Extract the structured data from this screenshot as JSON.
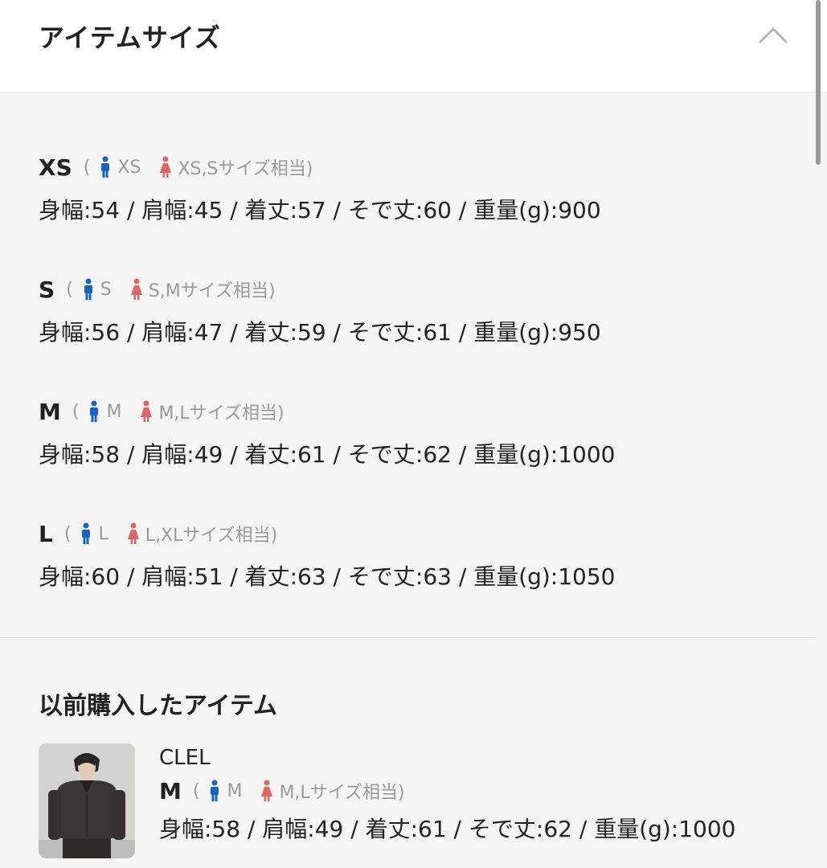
{
  "header": {
    "title": "アイテムサイズ"
  },
  "sizes": [
    {
      "name": "XS",
      "open": "(",
      "male": "XS",
      "female": "XS,Sサイズ相当)",
      "measurements": "身幅:54 / 肩幅:45 / 着丈:57 / そで丈:60 / 重量(g):900"
    },
    {
      "name": "S",
      "open": "(",
      "male": "S",
      "female": "S,Mサイズ相当)",
      "measurements": "身幅:56 / 肩幅:47 / 着丈:59 / そで丈:61 / 重量(g):950"
    },
    {
      "name": "M",
      "open": "(",
      "male": "M",
      "female": "M,Lサイズ相当)",
      "measurements": "身幅:58 / 肩幅:49 / 着丈:61 / そで丈:62 / 重量(g):1000"
    },
    {
      "name": "L",
      "open": "(",
      "male": "L",
      "female": "L,XLサイズ相当)",
      "measurements": "身幅:60 / 肩幅:51 / 着丈:63 / そで丈:63 / 重量(g):1050"
    }
  ],
  "purchased": {
    "title": "以前購入したアイテム",
    "item": {
      "brand": "CLEL",
      "size": "M",
      "open": "(",
      "male": "M",
      "female": "M,Lサイズ相当)",
      "measurements": "身幅:58 / 肩幅:49 / 着丈:61 / そで丈:62 / 重量(g):1000"
    }
  },
  "colors": {
    "male_icon": "#1565c0",
    "female_icon": "#e06666",
    "muted_text": "#9a9a9a"
  }
}
